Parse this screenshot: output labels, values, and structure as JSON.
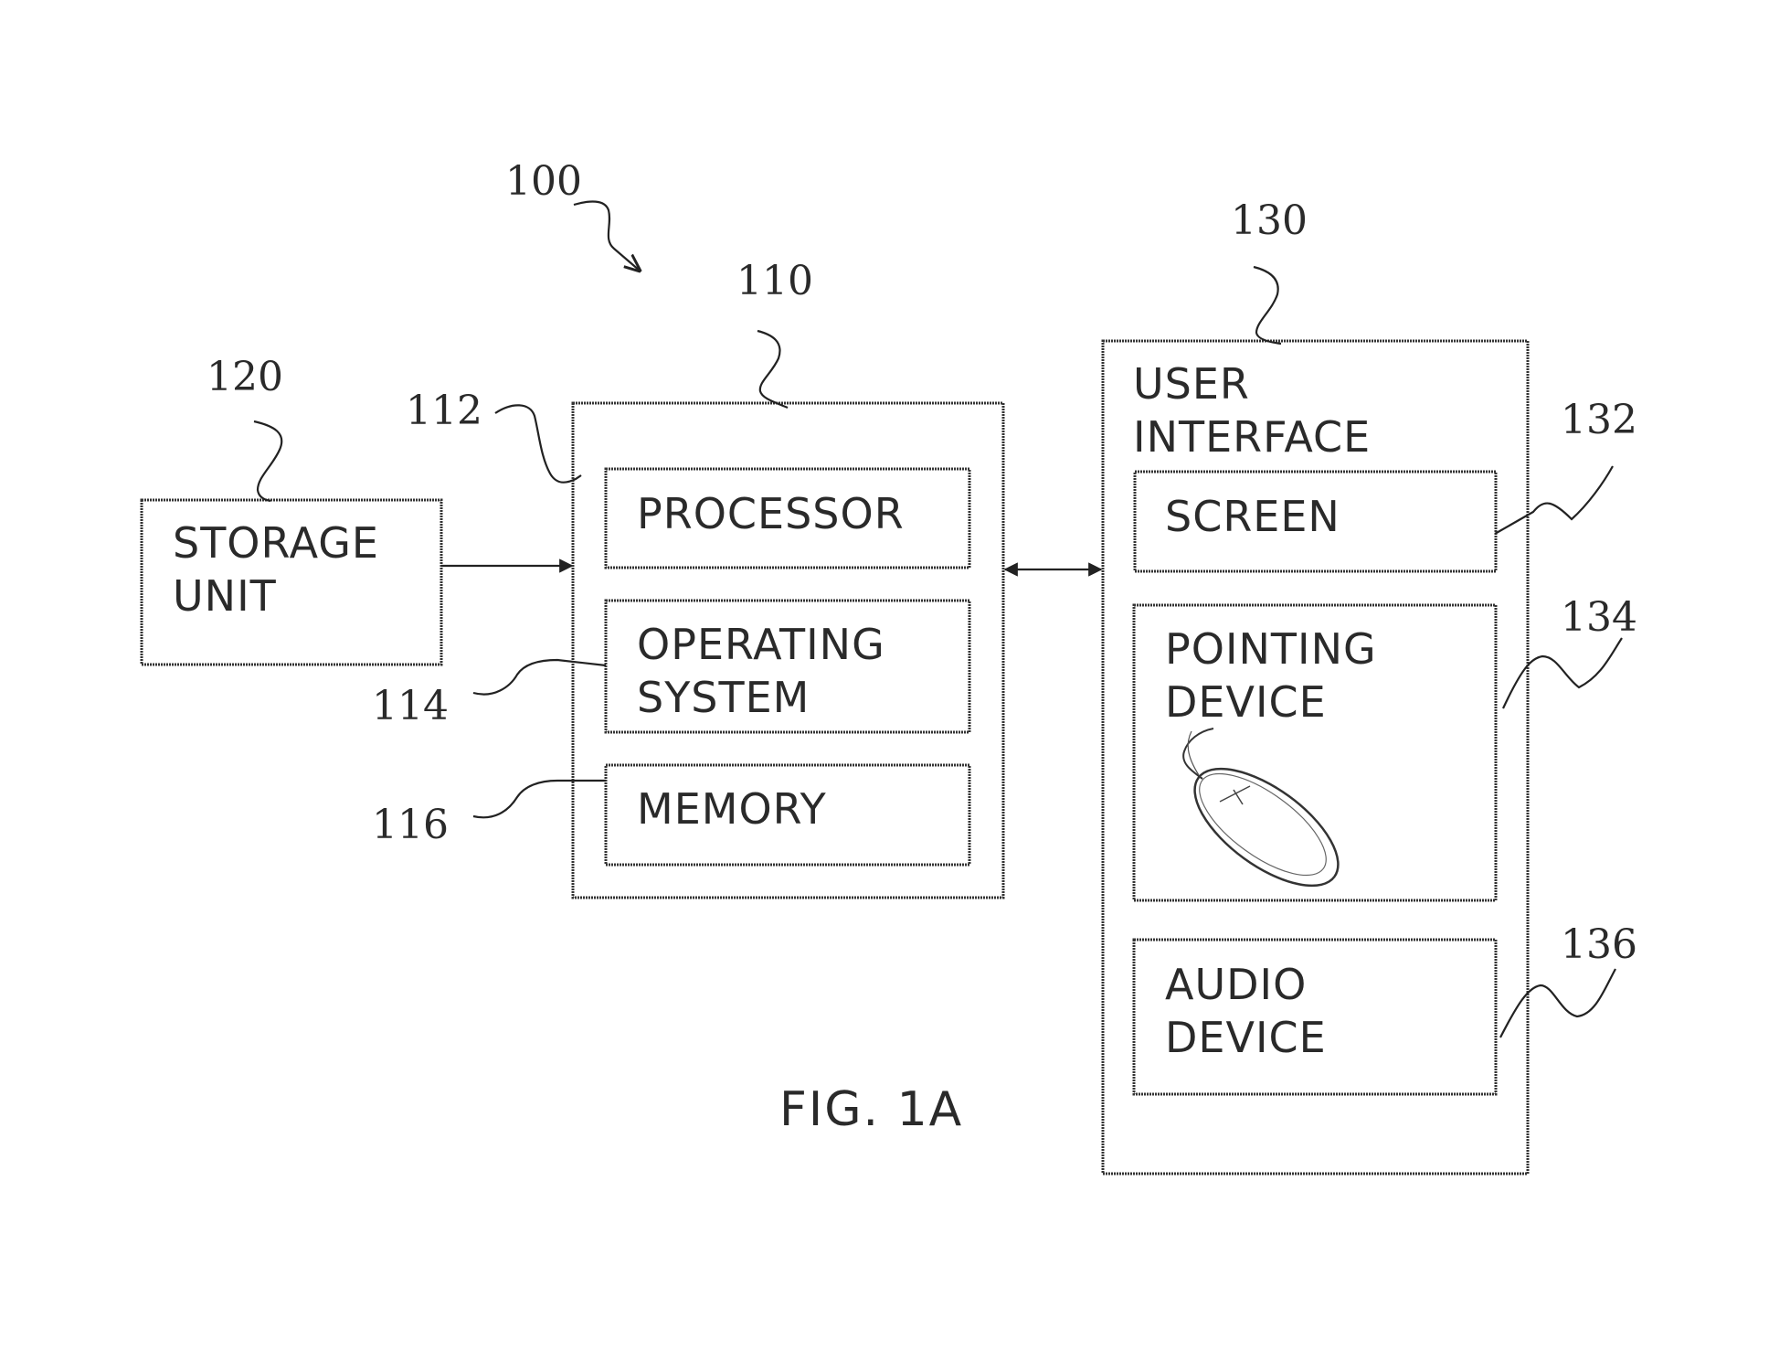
{
  "figure": {
    "caption": "FIG. 1A",
    "system_ref": "100"
  },
  "storage_unit": {
    "ref": "120",
    "label_lines": [
      "STORAGE",
      "UNIT"
    ]
  },
  "computer": {
    "ref": "110",
    "outer_ref": "112",
    "components": [
      {
        "ref": "",
        "label_lines": [
          "PROCESSOR"
        ]
      },
      {
        "ref": "114",
        "label_lines": [
          "OPERATING",
          "SYSTEM"
        ]
      },
      {
        "ref": "116",
        "label_lines": [
          "MEMORY"
        ]
      }
    ]
  },
  "user_interface": {
    "ref": "130",
    "label_lines": [
      "USER",
      "INTERFACE"
    ],
    "components": [
      {
        "ref": "132",
        "label_lines": [
          "SCREEN"
        ]
      },
      {
        "ref": "134",
        "label_lines": [
          "POINTING",
          "DEVICE"
        ],
        "icon": "mouse-icon"
      },
      {
        "ref": "136",
        "label_lines": [
          "AUDIO",
          "DEVICE"
        ]
      }
    ]
  },
  "connections": [
    {
      "from": "120",
      "to": "110",
      "direction": "one-way"
    },
    {
      "from": "110",
      "to": "130",
      "direction": "bidirectional"
    }
  ]
}
